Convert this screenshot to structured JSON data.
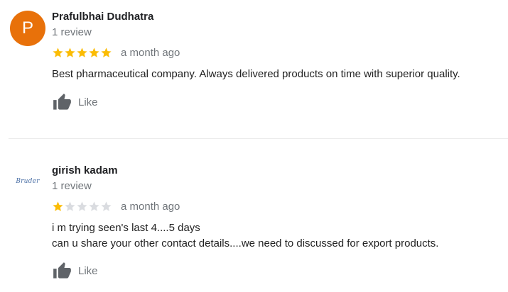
{
  "reviews": [
    {
      "avatar_letter": "P",
      "avatar_color": "#e8710a",
      "name": "Prafulbhai Dudhatra",
      "review_count": "1 review",
      "rating": 5,
      "max_rating": 5,
      "time": "a month ago",
      "text_lines": [
        "Best pharmaceutical company. Always delivered products on time with superior quality."
      ],
      "like_label": "Like",
      "like_icon": "thumbs-up-icon"
    },
    {
      "avatar_logo_text": "Bruder",
      "name": "girish kadam",
      "review_count": "1 review",
      "rating": 1,
      "max_rating": 5,
      "time": "a month ago",
      "text_lines": [
        "i m trying seen's last 4....5 days",
        "can u share your other contact details....we need to discussed for export products."
      ],
      "like_label": "Like",
      "like_icon": "thumbs-up-icon"
    }
  ],
  "colors": {
    "star_filled": "#fbbc04",
    "star_empty": "#dadce0",
    "secondary_text": "#70757a",
    "like_icon": "#5f6368"
  }
}
